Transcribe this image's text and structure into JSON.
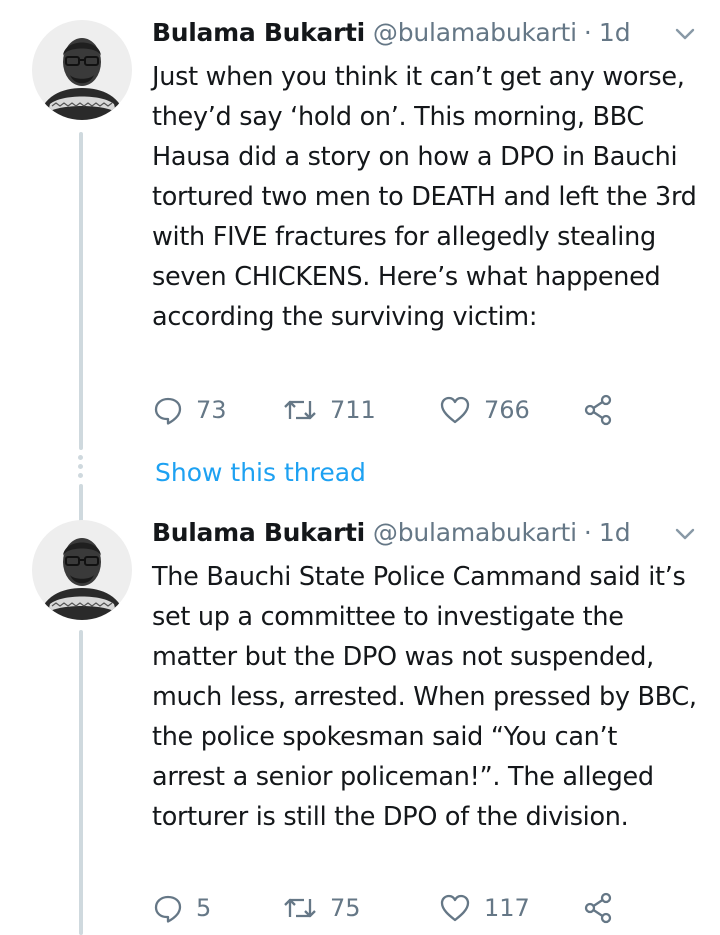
{
  "colors": {
    "text": "#14171a",
    "secondary": "#657786",
    "link": "#1da1f2",
    "thread_line": "#cfd9de"
  },
  "tweets": [
    {
      "author_name": "Bulama Bukarti",
      "handle": "@bulamabukarti",
      "separator": "·",
      "time": "1d",
      "text": "Just when you think it can’t get any worse, they’d say ‘hold on’. This morning, BBC Hausa did a story on how a DPO in Bauchi tortured two men to DEATH and left the 3rd with FIVE fractures for allegedly stealing seven CHICKENS. Here’s what happened according the surviving victim:",
      "replies": "73",
      "retweets": "711",
      "likes": "766",
      "show_thread": "Show this thread"
    },
    {
      "author_name": "Bulama Bukarti",
      "handle": "@bulamabukarti",
      "separator": "·",
      "time": "1d",
      "text": "The Bauchi State Police Cammand said it’s set up a committee to investigate the matter but the DPO was not suspended, much less, arrested. When pressed by BBC, the police spokesman said “You can’t arrest a senior policeman!”. The alleged torturer is still the DPO of the division.",
      "replies": "5",
      "retweets": "75",
      "likes": "117"
    }
  ],
  "icons": {
    "reply": "reply-icon",
    "retweet": "retweet-icon",
    "like": "heart-icon",
    "share": "share-icon",
    "menu": "chevron-down-icon"
  }
}
